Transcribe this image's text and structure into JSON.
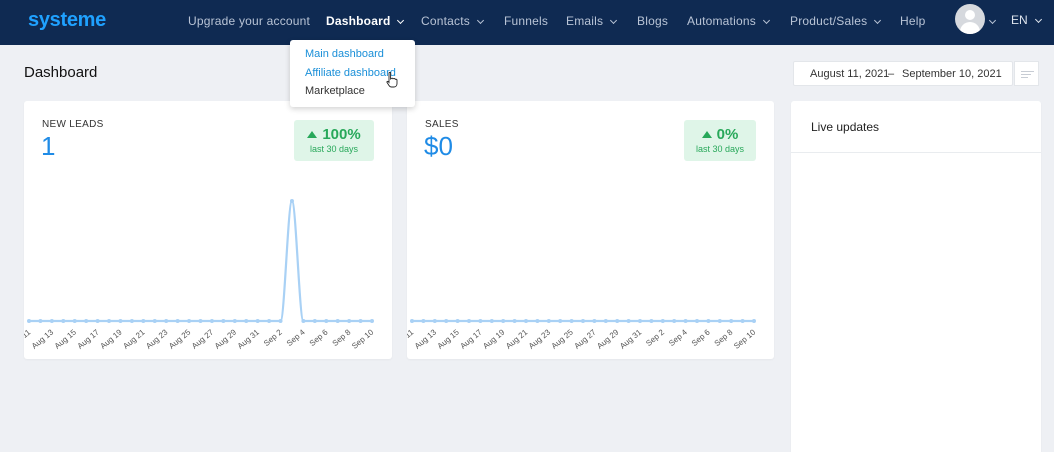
{
  "app": {
    "logo": "systeme"
  },
  "nav": {
    "items": [
      {
        "label": "Upgrade your account",
        "dropdown": false,
        "active": false
      },
      {
        "label": "Dashboard",
        "dropdown": true,
        "active": true
      },
      {
        "label": "Contacts",
        "dropdown": true,
        "active": false
      },
      {
        "label": "Funnels",
        "dropdown": false,
        "active": false
      },
      {
        "label": "Emails",
        "dropdown": true,
        "active": false
      },
      {
        "label": "Blogs",
        "dropdown": false,
        "active": false
      },
      {
        "label": "Automations",
        "dropdown": true,
        "active": false
      },
      {
        "label": "Product/Sales",
        "dropdown": true,
        "active": false
      },
      {
        "label": "Help",
        "dropdown": false,
        "active": false
      }
    ],
    "language": "EN"
  },
  "dropdown": {
    "items": [
      {
        "label": "Main dashboard"
      },
      {
        "label": "Affiliate dashboard"
      },
      {
        "label": "Marketplace"
      }
    ]
  },
  "page": {
    "title": "Dashboard"
  },
  "date_range": {
    "start": "August 11, 2021",
    "separator": "–",
    "end": "September 10, 2021"
  },
  "cards": {
    "leads": {
      "label": "NEW LEADS",
      "value": "1",
      "badge_value": "100%",
      "badge_period": "last 30 days"
    },
    "sales": {
      "label": "SALES",
      "value": "$0",
      "badge_value": "0%",
      "badge_period": "last 30 days"
    }
  },
  "live_updates": {
    "title": "Live updates"
  },
  "colors": {
    "nav_bg": "#0f2a52",
    "accent": "#1f8be6",
    "positive": "#28a85a",
    "chart_line": "#a9d1f5"
  },
  "chart_data": [
    {
      "type": "line",
      "title": "NEW LEADS",
      "x_ticks": [
        "Aug 11",
        "Aug 13",
        "Aug 15",
        "Aug 17",
        "Aug 19",
        "Aug 21",
        "Aug 23",
        "Aug 25",
        "Aug 27",
        "Aug 29",
        "Aug 31",
        "Sep 2",
        "Sep 4",
        "Sep 6",
        "Sep 8",
        "Sep 10"
      ],
      "x": [
        "Aug 11",
        "Aug 12",
        "Aug 13",
        "Aug 14",
        "Aug 15",
        "Aug 16",
        "Aug 17",
        "Aug 18",
        "Aug 19",
        "Aug 20",
        "Aug 21",
        "Aug 22",
        "Aug 23",
        "Aug 24",
        "Aug 25",
        "Aug 26",
        "Aug 27",
        "Aug 28",
        "Aug 29",
        "Aug 30",
        "Aug 31",
        "Sep 1",
        "Sep 2",
        "Sep 3",
        "Sep 4",
        "Sep 5",
        "Sep 6",
        "Sep 7",
        "Sep 8",
        "Sep 9",
        "Sep 10"
      ],
      "values": [
        0,
        0,
        0,
        0,
        0,
        0,
        0,
        0,
        0,
        0,
        0,
        0,
        0,
        0,
        0,
        0,
        0,
        0,
        0,
        0,
        0,
        0,
        0,
        1,
        0,
        0,
        0,
        0,
        0,
        0,
        0
      ],
      "ylim": [
        0,
        1
      ],
      "grid": false
    },
    {
      "type": "line",
      "title": "SALES",
      "x_ticks": [
        "Aug 11",
        "Aug 13",
        "Aug 15",
        "Aug 17",
        "Aug 19",
        "Aug 21",
        "Aug 23",
        "Aug 25",
        "Aug 27",
        "Aug 29",
        "Aug 31",
        "Sep 2",
        "Sep 4",
        "Sep 6",
        "Sep 8",
        "Sep 10"
      ],
      "x": [
        "Aug 11",
        "Aug 12",
        "Aug 13",
        "Aug 14",
        "Aug 15",
        "Aug 16",
        "Aug 17",
        "Aug 18",
        "Aug 19",
        "Aug 20",
        "Aug 21",
        "Aug 22",
        "Aug 23",
        "Aug 24",
        "Aug 25",
        "Aug 26",
        "Aug 27",
        "Aug 28",
        "Aug 29",
        "Aug 30",
        "Aug 31",
        "Sep 1",
        "Sep 2",
        "Sep 3",
        "Sep 4",
        "Sep 5",
        "Sep 6",
        "Sep 7",
        "Sep 8",
        "Sep 9",
        "Sep 10"
      ],
      "values": [
        0,
        0,
        0,
        0,
        0,
        0,
        0,
        0,
        0,
        0,
        0,
        0,
        0,
        0,
        0,
        0,
        0,
        0,
        0,
        0,
        0,
        0,
        0,
        0,
        0,
        0,
        0,
        0,
        0,
        0,
        0
      ],
      "ylim": [
        0,
        1
      ],
      "grid": false
    }
  ]
}
